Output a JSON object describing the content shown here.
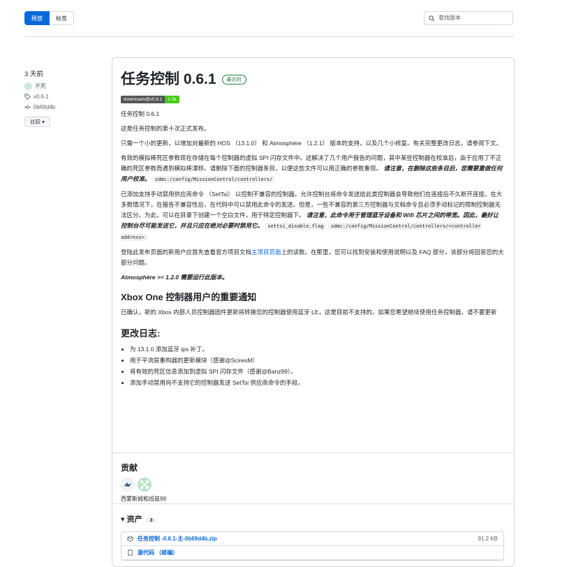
{
  "tabs": [
    {
      "label": "释放",
      "active": true
    },
    {
      "label": "标签",
      "active": false
    }
  ],
  "search": {
    "placeholder": "查找版本"
  },
  "meta": {
    "time": "3 天前",
    "author": "不死",
    "tag": "v0.6.1",
    "commit": "0b69d4b",
    "compare_label": "比较 ▾"
  },
  "release": {
    "title": "任务控制 0.6.1",
    "latest_label": "最近的",
    "badge_left": "downloads@v0.6.1",
    "badge_right": "2.3k",
    "p_version": "任务控制 0.6.1",
    "p_tenth": "这是任务控制的第十次正式发布。",
    "p_small_update": "只需一个小的更新，以增加对最新的 HOS （13.1.0） 和 Atmosphère （1.2.1） 版本的支持，以及几个小修复。有关完整更改日志，请参阅下文。",
    "p_spi_1": "有效的模拟棒死区参数现在存储在每个控制器的虚拟 SPI 闪存文件中。这解决了几个用户报告的问题，其中某些控制器在校准后，由于应用了不正确的死区参数而遇到模拟棒漂移。请删除下面的控制器条目，以便这些文件可以用正确的参数重现。",
    "p_spi_bold": "请注意，在删除这些条目后，您需要重做任何用户校准。",
    "code_controllers": "sdmc:/config/MissionControl/controllers/",
    "p_settsi_1": "已添加支持手动禁用供应商命令 （SetTsi） 以控制不兼容的控制器。允许控制台将命令发送给此类控制器会导致他们在连接后不久断开连接。在大多数情况下，在报告不兼容性后，在代码中可以禁用此命令的发送。但是，一些不兼容的第三方控制器与文档命令且必须手动标记的限制控制器无法区分。为此，可以在目录下创建一个空白文件，用于特定控制器下。",
    "p_settsi_bold": "请注意，此命令用于管理蓝牙设备和 Wifi 芯片之间的带宽。因此，最好让控制台尽可能发送它，并且只应在绝对必要时禁用它。",
    "code_settsi": "settsi_disable.flag",
    "code_settsi_path": "sdmc:/config/MissionControl/controllers/<controller address>",
    "p_readme_1": "登陆此发布页面的新用户应首先查看官方项目文档",
    "p_readme_link": "主项目页面",
    "p_readme_2": "上的读数。在那里，您可以找到安装和使用说明以及 FAQ 部分，该部分将回答您的大部分问题。",
    "p_atmo": "Atmosphère >= 1.2.0 需要运行此版本。",
    "h_xbox": "Xbox One 控制器用户的重要通知",
    "p_xbox": "已确认，新的 Xbox 内部人员控制器固件更新将转换您的控制器使用蓝牙 LE，这是目前不支持的。如果您希望继续使用任务控制器，请不要更新",
    "h_changelog": "更改日志:",
    "changes": [
      "为 13.1.0 添加蓝牙 ips 补丁。",
      "用于平流层重构器的更新模块（感谢@SciresM）",
      "将有效的死区信息添加到虚拟 SPI 闪存文件（感谢@Banz99）。",
      "添加手动禁用向不支持它的控制器发送 SetTsi 供应商命令的手段。"
    ]
  },
  "contrib": {
    "title": "贡献",
    "names": "西蒙斯姆和班兹99"
  },
  "assets": {
    "title": "▾ 资产",
    "count": "3",
    "items": [
      {
        "name": "任务控制 -0.6.1-主-0b69d4b.zip",
        "size": "91.2 KB"
      },
      {
        "name": "源代码 （邮编）",
        "size": ""
      }
    ]
  }
}
